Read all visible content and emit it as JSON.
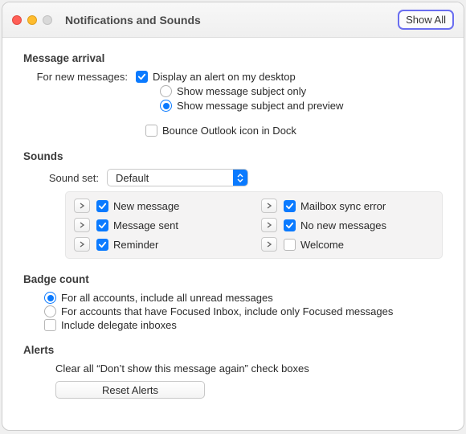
{
  "window": {
    "title": "Notifications and Sounds",
    "showAll": "Show All"
  },
  "messageArrival": {
    "heading": "Message arrival",
    "leadLabel": "For new messages:",
    "displayAlert": {
      "label": "Display an alert on my desktop",
      "checked": true
    },
    "subjectOnly": {
      "label": "Show message subject only",
      "selected": false
    },
    "subjectPreview": {
      "label": "Show message subject and preview",
      "selected": true
    },
    "bounceDock": {
      "label": "Bounce Outlook icon in Dock",
      "checked": false
    }
  },
  "sounds": {
    "heading": "Sounds",
    "setLabel": "Sound set:",
    "setValue": "Default",
    "items": [
      {
        "label": "New message",
        "checked": true
      },
      {
        "label": "Mailbox sync error",
        "checked": true
      },
      {
        "label": "Message sent",
        "checked": true
      },
      {
        "label": "No new messages",
        "checked": true
      },
      {
        "label": "Reminder",
        "checked": true
      },
      {
        "label": "Welcome",
        "checked": false
      }
    ]
  },
  "badge": {
    "heading": "Badge count",
    "allAccounts": {
      "label": "For all accounts, include all unread messages",
      "selected": true
    },
    "focused": {
      "label": "For accounts that have Focused Inbox, include only Focused messages",
      "selected": false
    },
    "delegate": {
      "label": "Include delegate inboxes",
      "checked": false
    }
  },
  "alerts": {
    "heading": "Alerts",
    "text": "Clear all “Don’t show this message again” check boxes",
    "reset": "Reset Alerts"
  }
}
